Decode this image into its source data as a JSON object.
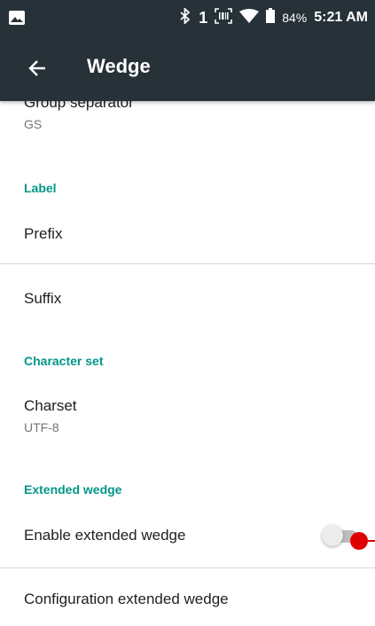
{
  "status_bar": {
    "sim": "1",
    "battery": "84%",
    "time": "5:21 AM",
    "icons": [
      "image-icon",
      "bluetooth-icon",
      "barcode-icon",
      "wifi-icon",
      "battery-icon"
    ]
  },
  "app_bar": {
    "back_icon": "arrow-back-icon",
    "title": "Wedge"
  },
  "list": {
    "group_separator": {
      "title": "Group separator",
      "summary": "GS"
    },
    "label_category": "Label",
    "prefix": {
      "title": "Prefix"
    },
    "suffix": {
      "title": "Suffix"
    },
    "charset_category": "Character set",
    "charset": {
      "title": "Charset",
      "summary": "UTF-8"
    },
    "extended_category": "Extended wedge",
    "enable_extended": {
      "title": "Enable extended wedge",
      "enabled": false
    },
    "config_extended": {
      "title": "Configuration extended wedge"
    }
  },
  "colors": {
    "app_bar": "#263238",
    "accent": "#009688",
    "touch_indicator": "#e00000"
  }
}
